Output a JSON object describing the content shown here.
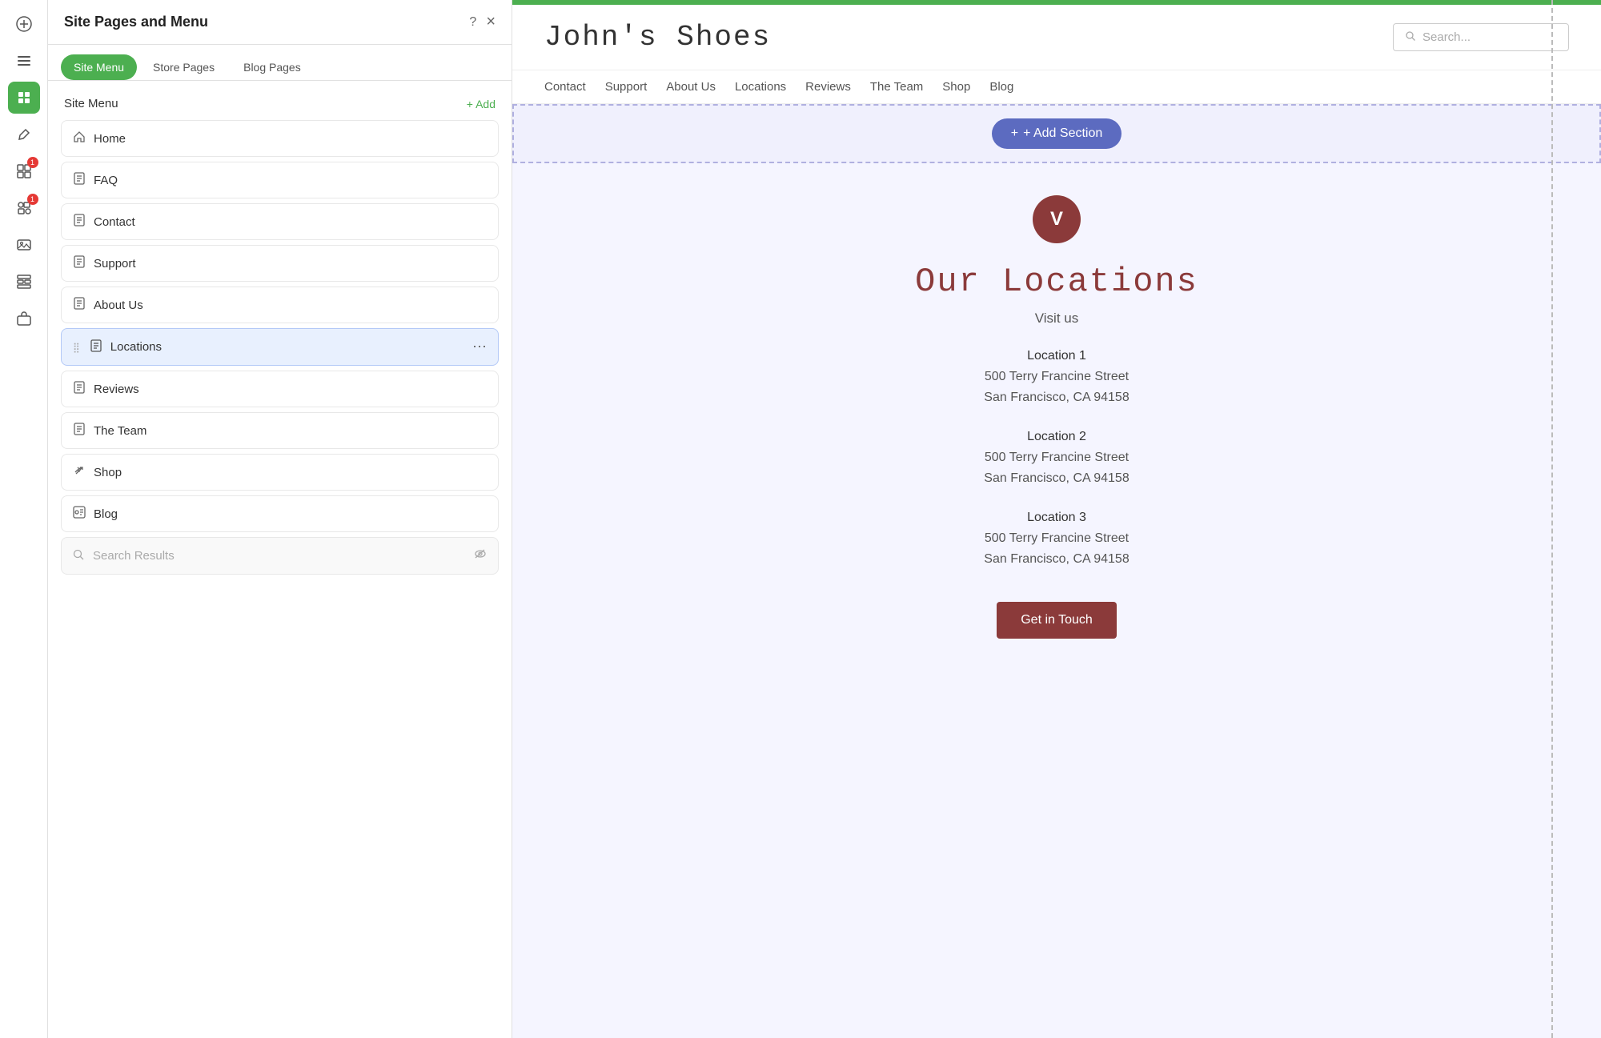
{
  "app": {
    "title": "Site Pages and Menu"
  },
  "left_sidebar": {
    "icons": [
      {
        "name": "add-icon",
        "symbol": "+",
        "active": false
      },
      {
        "name": "pages-icon",
        "symbol": "☰",
        "active": false
      },
      {
        "name": "design-icon",
        "symbol": "✏",
        "active": true
      },
      {
        "name": "brush-icon",
        "symbol": "🖌",
        "active": false
      },
      {
        "name": "apps-icon",
        "symbol": "⊞",
        "active": false,
        "badge": "1"
      },
      {
        "name": "widgets-icon",
        "symbol": "❖",
        "active": false,
        "badge": "1"
      },
      {
        "name": "media-icon",
        "symbol": "⬜",
        "active": false
      },
      {
        "name": "grid-icon",
        "symbol": "▦",
        "active": false
      },
      {
        "name": "bag-icon",
        "symbol": "🗃",
        "active": false
      }
    ]
  },
  "panel": {
    "header": {
      "title": "Site Pages and Menu",
      "help_label": "?",
      "close_label": "×"
    },
    "tabs": [
      {
        "label": "Site Menu",
        "active": true
      },
      {
        "label": "Store Pages",
        "active": false
      },
      {
        "label": "Blog Pages",
        "active": false
      }
    ],
    "site_menu": {
      "label": "Site Menu",
      "add_label": "+ Add",
      "items": [
        {
          "label": "Home",
          "icon": "home",
          "type": "page",
          "active": false
        },
        {
          "label": "FAQ",
          "icon": "page",
          "type": "page",
          "active": false
        },
        {
          "label": "Contact",
          "icon": "page",
          "type": "page",
          "active": false
        },
        {
          "label": "Support",
          "icon": "page",
          "type": "page",
          "active": false
        },
        {
          "label": "About Us",
          "icon": "page",
          "type": "page",
          "active": false
        },
        {
          "label": "Locations",
          "icon": "page",
          "type": "page",
          "active": true
        },
        {
          "label": "Reviews",
          "icon": "page",
          "type": "page",
          "active": false
        },
        {
          "label": "The Team",
          "icon": "page",
          "type": "page",
          "active": false
        },
        {
          "label": "Shop",
          "icon": "link",
          "type": "link",
          "active": false
        },
        {
          "label": "Blog",
          "icon": "blog",
          "type": "blog",
          "active": false
        }
      ],
      "search_results": {
        "label": "Search Results",
        "icon": "search"
      }
    }
  },
  "site_preview": {
    "title": "John's Shoes",
    "search_placeholder": "Search...",
    "nav_items": [
      "Contact",
      "Support",
      "About Us",
      "Locations",
      "Reviews",
      "The Team",
      "Shop",
      "Blog"
    ],
    "add_section_label": "+ Add Section",
    "logo_letter": "V",
    "section_title": "Our Locations",
    "visit_us": "Visit us",
    "locations": [
      {
        "name": "Location 1",
        "street": "500 Terry Francine Street",
        "city": "San Francisco, CA 94158"
      },
      {
        "name": "Location 2",
        "street": "500 Terry Francine Street",
        "city": "San Francisco, CA 94158"
      },
      {
        "name": "Location 3",
        "street": "500 Terry Francine Street",
        "city": "San Francisco, CA 94158"
      }
    ],
    "cta_button": "Get in Touch"
  }
}
